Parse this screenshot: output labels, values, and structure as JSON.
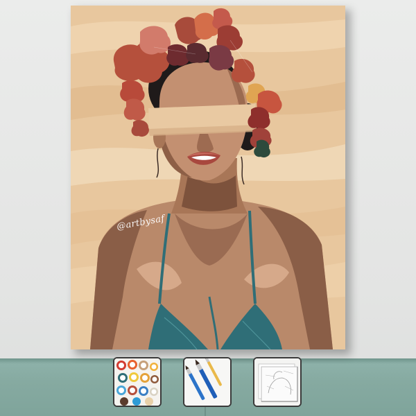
{
  "artwork": {
    "signature": "@artbysaf"
  },
  "kit_icons": [
    "paint-pots-icon",
    "brushes-icon",
    "numbered-canvas-icon"
  ],
  "colors": {
    "background_tan": "#e8c79e",
    "sofa_teal": "#86aaa1",
    "skin_mid": "#b98a6a",
    "skin_shadow": "#6f4a37",
    "bikini_teal": "#2f6e77",
    "flower_red": "#b5503c"
  }
}
